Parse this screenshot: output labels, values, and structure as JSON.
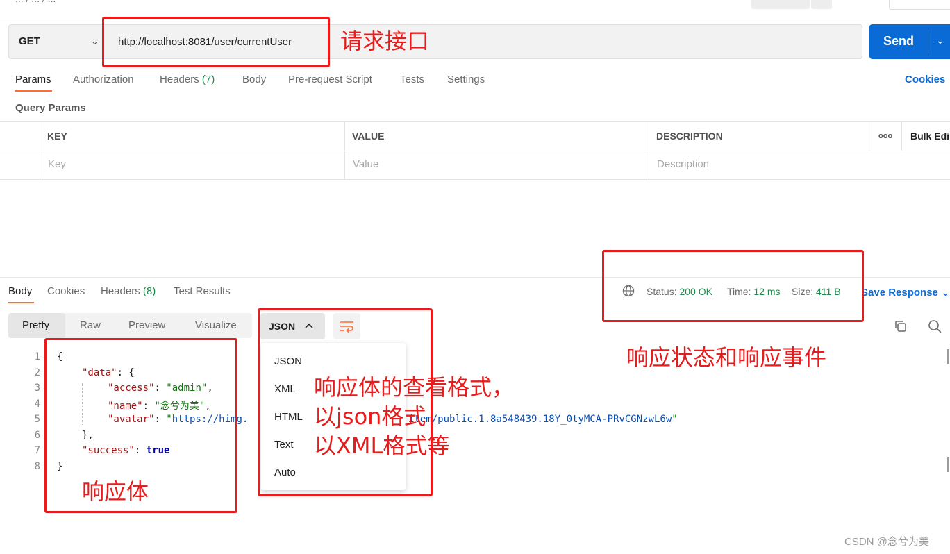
{
  "top": {
    "crumb": "... / ... / ..."
  },
  "request": {
    "method": "GET",
    "url": "http://localhost:8081/user/currentUser",
    "send_label": "Send"
  },
  "request_tabs": {
    "params": "Params",
    "authorization": "Authorization",
    "headers": "Headers",
    "headers_count": "(7)",
    "body": "Body",
    "pre_request": "Pre-request Script",
    "tests": "Tests",
    "settings": "Settings",
    "cookies": "Cookies"
  },
  "query_params": {
    "title": "Query Params",
    "columns": {
      "key": "KEY",
      "value": "VALUE",
      "description": "DESCRIPTION",
      "more": "ooo",
      "bulk_edit": "Bulk Edi"
    },
    "placeholders": {
      "key": "Key",
      "value": "Value",
      "description": "Description"
    }
  },
  "response_tabs": {
    "body": "Body",
    "cookies": "Cookies",
    "headers": "Headers",
    "headers_count": "(8)",
    "test_results": "Test Results"
  },
  "response_meta": {
    "status_label": "Status:",
    "status_value": "200 OK",
    "time_label": "Time:",
    "time_value": "12 ms",
    "size_label": "Size:",
    "size_value": "411 B",
    "save_response": "Save Response"
  },
  "view_modes": {
    "pretty": "Pretty",
    "raw": "Raw",
    "preview": "Preview",
    "visualize": "Visualize"
  },
  "format": {
    "selected": "JSON",
    "options": [
      "JSON",
      "XML",
      "HTML",
      "Text",
      "Auto"
    ]
  },
  "code": {
    "line_numbers": [
      "1",
      "2",
      "3",
      "4",
      "5",
      "6",
      "7",
      "8"
    ],
    "l1": "{",
    "l2_key": "\"data\"",
    "l2_rest": ": {",
    "l3_key": "\"access\"",
    "l3_colon": ": ",
    "l3_val": "\"admin\"",
    "l3_end": ",",
    "l4_key": "\"name\"",
    "l4_colon": ": ",
    "l4_val": "\"念兮为美\"",
    "l4_end": ",",
    "l5_key": "\"avatar\"",
    "l5_colon": ": ",
    "l5_q": "\"",
    "l5_link_a": "https://himg.",
    "l5_link_b": "item/public.1.8a548439.18Y_0tyMCA-PRvCGNzwL6w",
    "l5_q2": "\"",
    "l6": "},",
    "l7_key": "\"success\"",
    "l7_colon": ": ",
    "l7_val": "true",
    "l8": "}"
  },
  "annotations": {
    "request_api": "请求接口",
    "response_status": "响应状态和响应事件",
    "format_line1": "响应体的查看格式，",
    "format_line2": "以json格式",
    "format_line3": "以XML格式等",
    "response_body": "响应体"
  },
  "watermark": "CSDN @念兮为美",
  "colors": {
    "accent_send": "#0b6bd6",
    "tab_underline": "#ff6c37",
    "annotation_red": "#e81c1c",
    "status_green": "#1f8a4c"
  }
}
